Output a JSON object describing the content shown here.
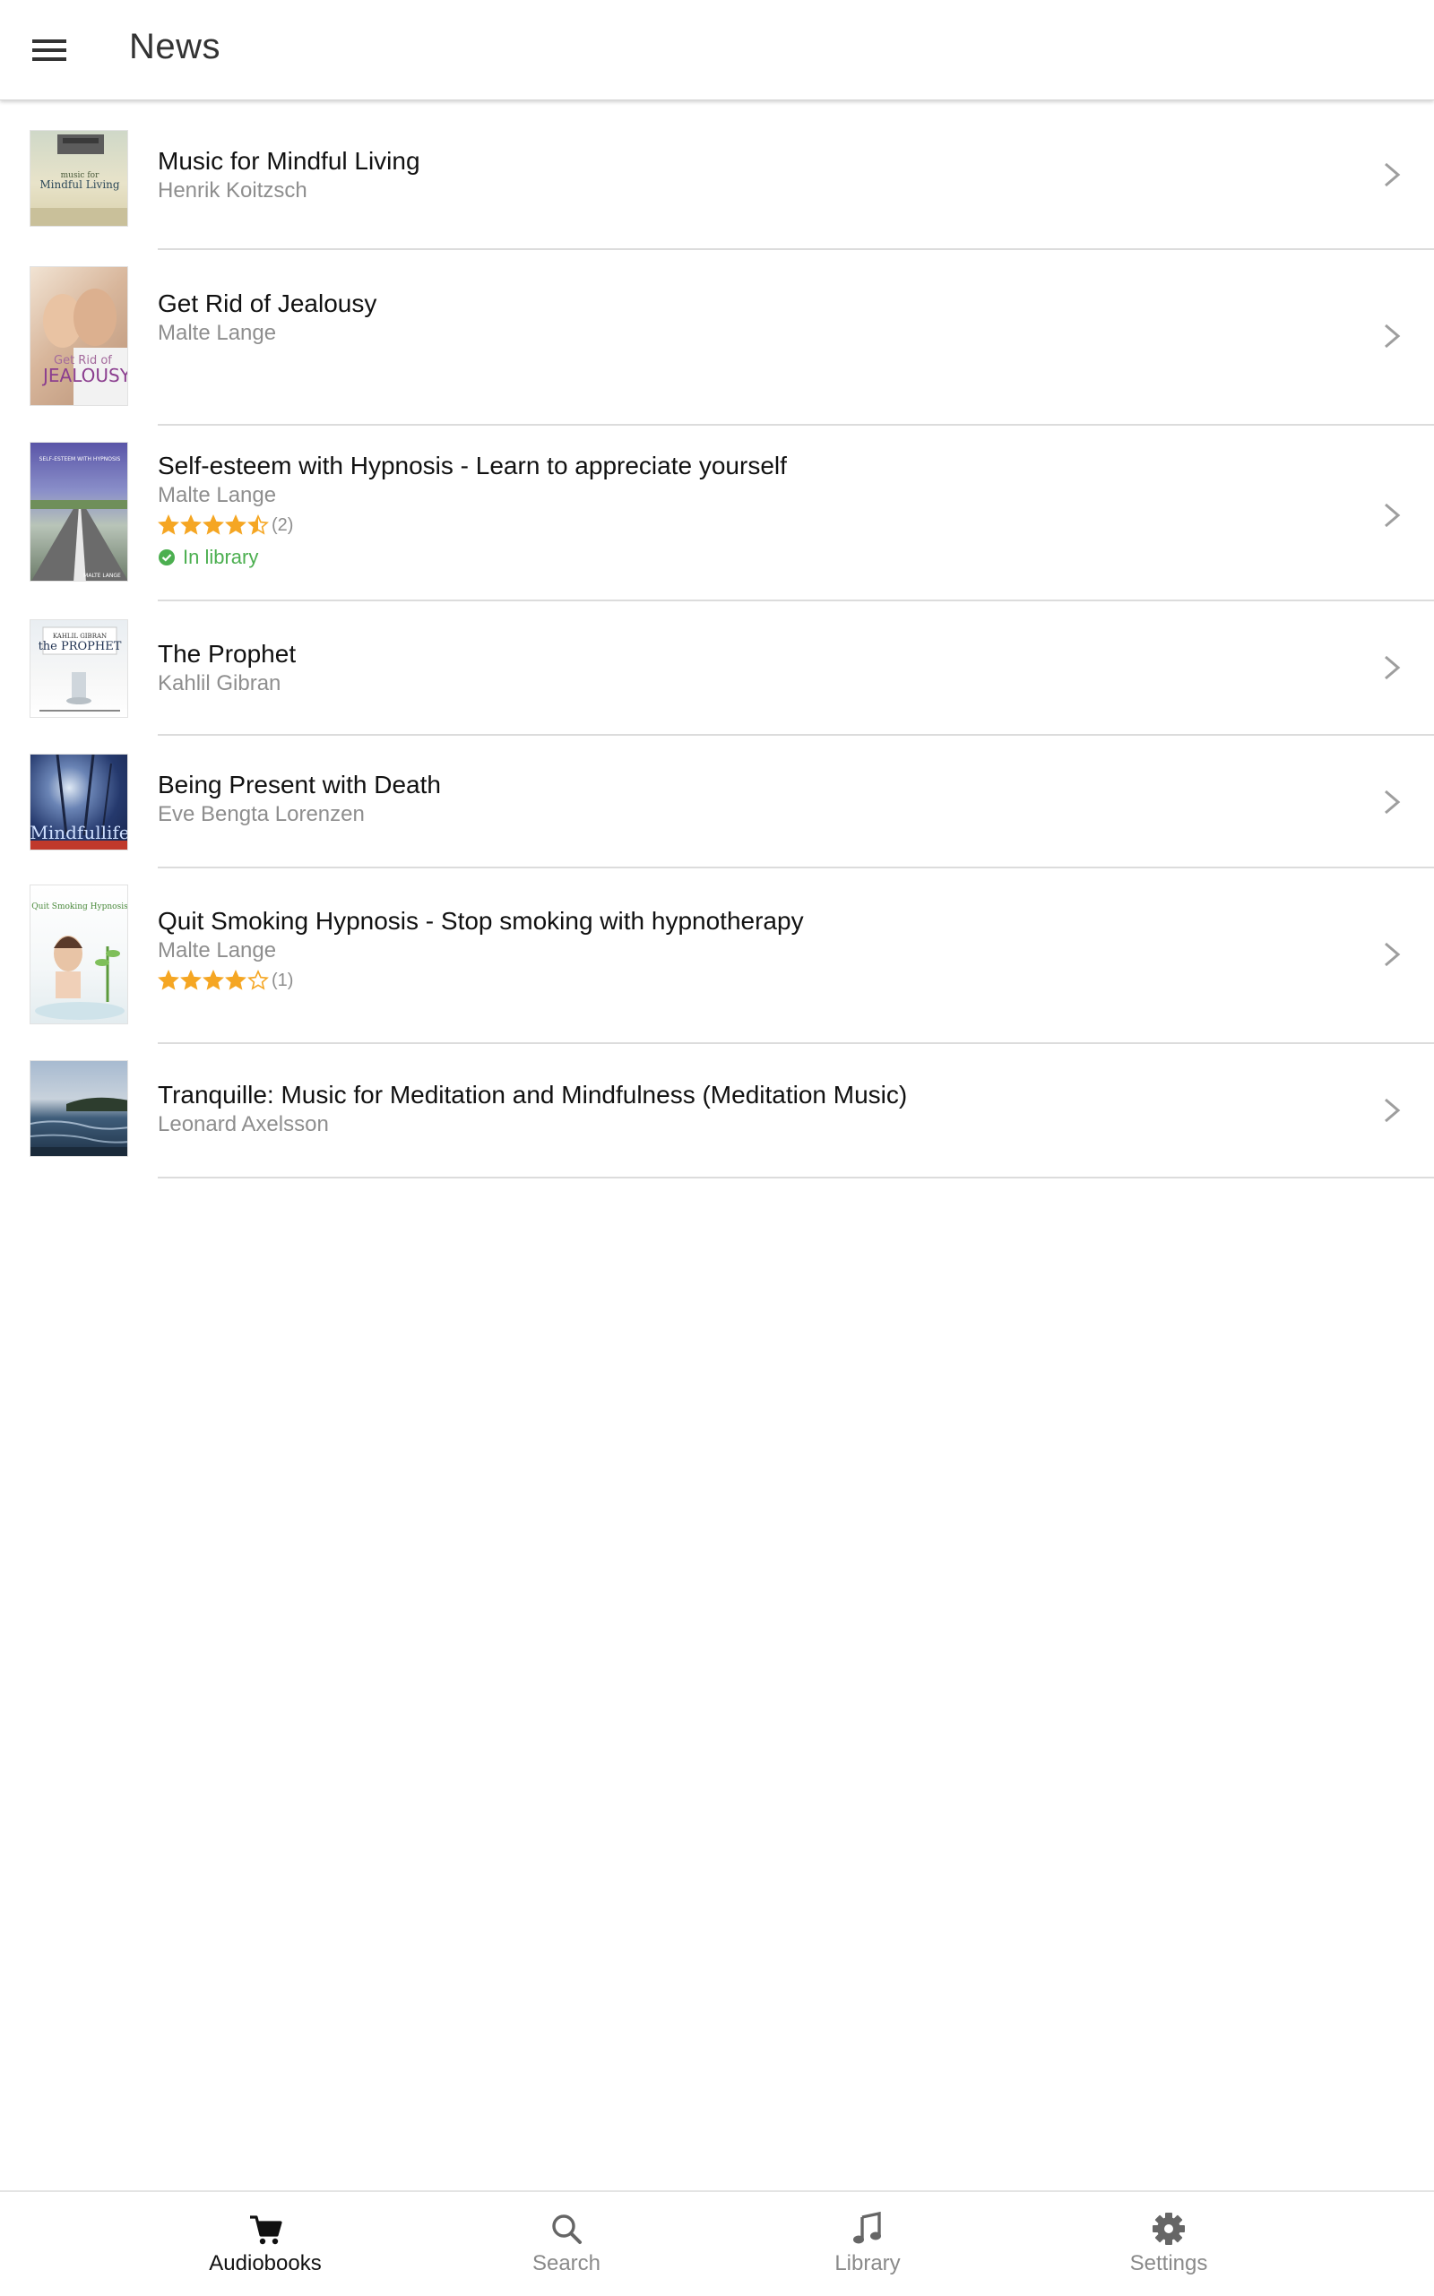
{
  "header": {
    "title": "News"
  },
  "items": [
    {
      "title": "Music for Mindful Living",
      "author": "Henrik Koitzsch",
      "cover_text": [
        "music for",
        "Mindful Living"
      ]
    },
    {
      "title": "Get Rid of Jealousy",
      "author": "Malte Lange",
      "cover_text": [
        "Get Rid of",
        "JEALOUSY"
      ]
    },
    {
      "title": "Self-esteem with Hypnosis - Learn to appreciate yourself",
      "author": "Malte Lange",
      "rating": 4.5,
      "rating_count": "(2)",
      "library_status": "In library",
      "cover_text": [
        "SELF-ESTEEM WITH HYPNOSIS",
        "MALTE LANGE"
      ]
    },
    {
      "title": "The Prophet",
      "author": "Kahlil Gibran",
      "cover_text": [
        "KAHLIL GIBRAN",
        "the PROPHET"
      ]
    },
    {
      "title": "Being Present with Death",
      "author": "Eve Bengta Lorenzen",
      "cover_text": [
        "Mindfullife"
      ]
    },
    {
      "title": "Quit Smoking Hypnosis - Stop smoking with hypnotherapy",
      "author": "Malte Lange",
      "rating": 4,
      "rating_count": "(1)",
      "cover_text": [
        "Quit Smoking Hypnosis"
      ]
    },
    {
      "title": "Tranquille: Music for Meditation and Mindfulness (Meditation Music)",
      "author": "Leonard Axelsson",
      "cover_text": []
    }
  ],
  "bottom_nav": [
    {
      "label": "Audiobooks",
      "icon": "cart-icon",
      "active": true
    },
    {
      "label": "Search",
      "icon": "search-icon",
      "active": false
    },
    {
      "label": "Library",
      "icon": "music-note-icon",
      "active": false
    },
    {
      "label": "Settings",
      "icon": "gear-icon",
      "active": false
    }
  ],
  "colors": {
    "star": "#f5a623",
    "library_green": "#4caf50",
    "secondary_text": "#8e8e8e",
    "chevron": "#9e9e9e"
  }
}
